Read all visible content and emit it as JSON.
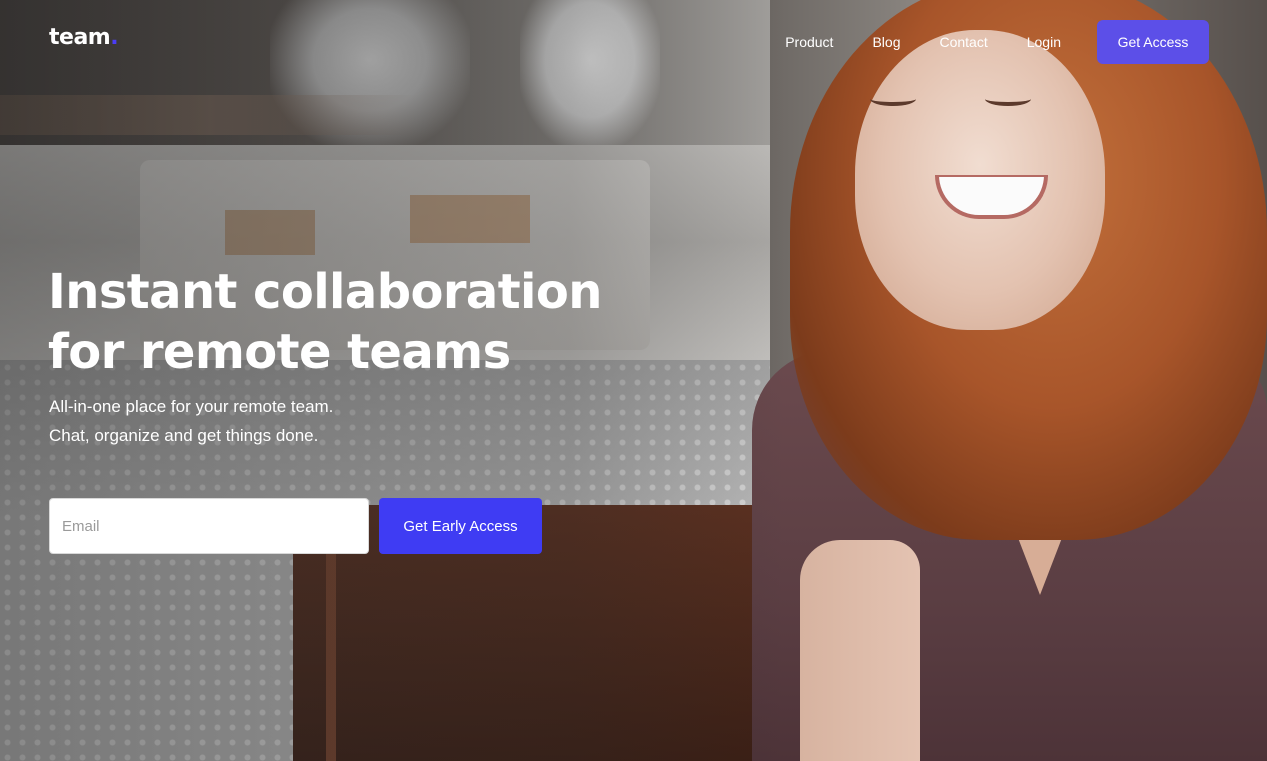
{
  "brand": {
    "name": "team",
    "dot": ".",
    "accent_color": "#4b3cf5"
  },
  "nav": {
    "items": [
      {
        "label": "Product"
      },
      {
        "label": "Blog"
      },
      {
        "label": "Contact"
      },
      {
        "label": "Login"
      }
    ],
    "cta_label": "Get Access"
  },
  "hero": {
    "headline": "Instant collaboration for remote teams",
    "subtitle_line1": "All-in-one place for your remote team.",
    "subtitle_line2": "Chat, organize and get things done.",
    "email_placeholder": "Email",
    "email_value": "",
    "submit_label": "Get Early Access",
    "button_color": "#3f3cf3"
  }
}
